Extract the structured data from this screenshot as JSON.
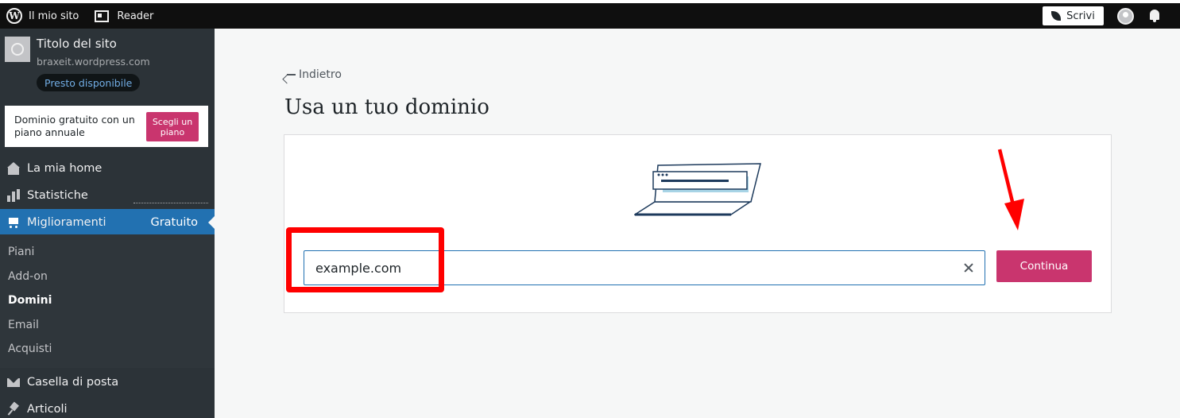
{
  "topbar": {
    "my_site": "Il mio sito",
    "reader": "Reader",
    "write": "Scrivi"
  },
  "sidebar": {
    "site_title": "Titolo del sito",
    "site_url": "braxeit.wordpress.com",
    "badge": "Presto disponibile",
    "promo_text": "Dominio gratuito con un piano annuale",
    "promo_button": "Scegli un piano",
    "items": [
      {
        "label": "La mia home",
        "icon": "home-icon"
      },
      {
        "label": "Statistiche",
        "icon": "stats-icon"
      },
      {
        "label": "Miglioramenti",
        "icon": "cart-icon",
        "badge": "Gratuito"
      },
      {
        "label": "Casella di posta",
        "icon": "mail-icon"
      },
      {
        "label": "Articoli",
        "icon": "pin-icon"
      }
    ],
    "submenu": [
      "Piani",
      "Add-on",
      "Domini",
      "Email",
      "Acquisti"
    ],
    "submenu_current": "Domini"
  },
  "main": {
    "back": "Indietro",
    "title": "Usa un tuo dominio",
    "input_value": "example.com",
    "continue": "Continua"
  },
  "colors": {
    "accent": "#2271b1",
    "primary_button": "#c9356e",
    "sidebar_bg": "#2c3338",
    "annotation": "#ff0000"
  }
}
